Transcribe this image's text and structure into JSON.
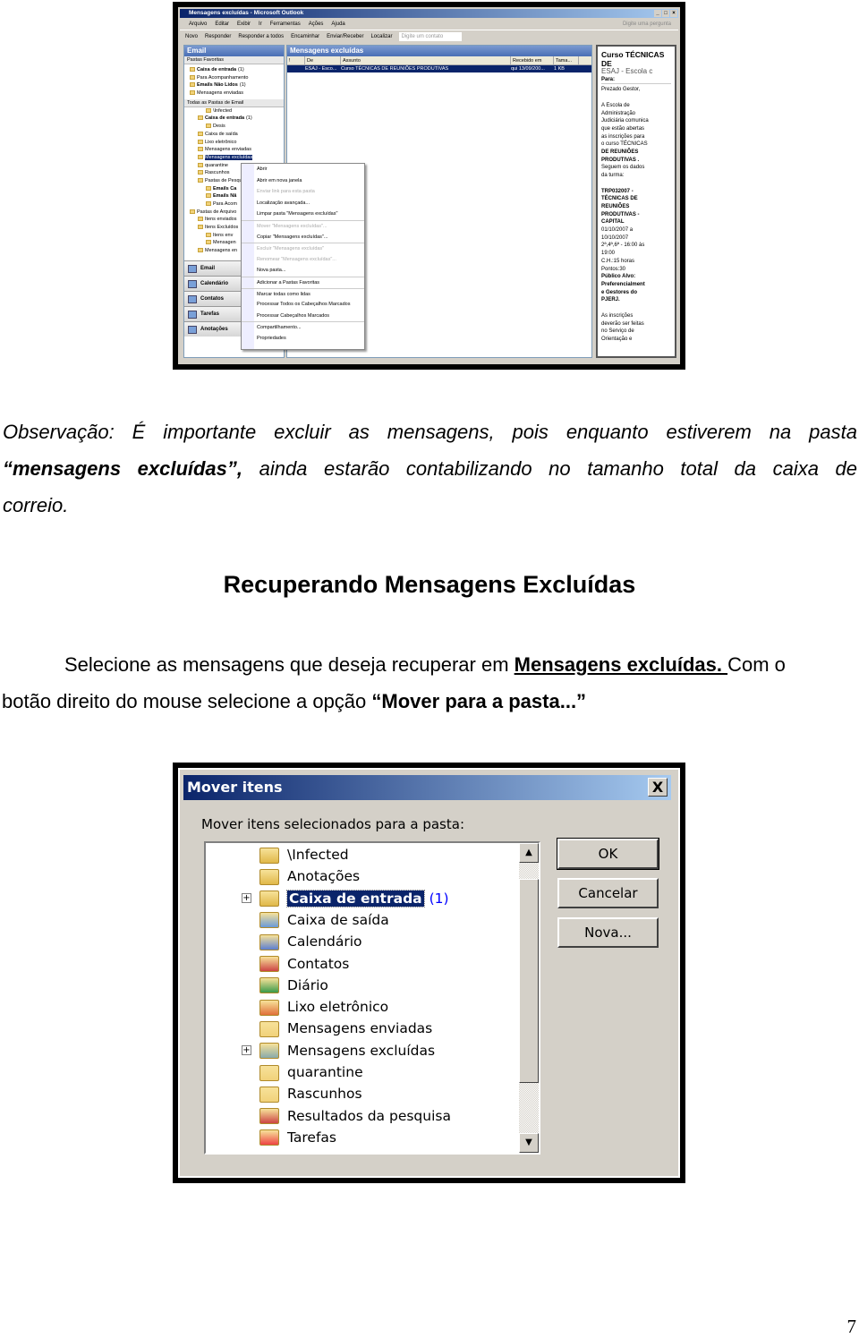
{
  "outlook": {
    "title": "Mensagens excluídas - Microsoft Outlook",
    "window_controls": [
      "_",
      "□",
      "×"
    ],
    "menu": [
      "Arquivo",
      "Editar",
      "Exibir",
      "Ir",
      "Ferramentas",
      "Ações",
      "Ajuda"
    ],
    "ask_placeholder": "Digite uma pergunta",
    "toolbar": [
      "Novo",
      "Responder",
      "Responder a todos",
      "Encaminhar",
      "Enviar/Receber",
      "Localizar"
    ],
    "contact_placeholder": "Digite um contato",
    "nav": {
      "header": "Email",
      "favorites_header": "Pastas Favoritas",
      "favorites": [
        {
          "label": "Caixa de entrada",
          "count": "(1)",
          "bold": true
        },
        {
          "label": "Para Acompanhamento"
        },
        {
          "label": "Emails Não Lidos",
          "count": "(1)",
          "bold": true
        },
        {
          "label": "Mensagens enviadas"
        }
      ],
      "all_header": "Todas as Pastas de Email",
      "tree": [
        {
          "label": "\\Infected",
          "lvl": 2
        },
        {
          "label": "Caixa de entrada",
          "count": "(1)",
          "lvl": 1,
          "bold": true
        },
        {
          "label": "Desis",
          "lvl": 2
        },
        {
          "label": "Caixa de saída",
          "lvl": 1
        },
        {
          "label": "Lixo eletrônico",
          "lvl": 1
        },
        {
          "label": "Mensagens enviadas",
          "lvl": 1
        },
        {
          "label": "Mensagens excluídas",
          "lvl": 1,
          "sel": true
        },
        {
          "label": "quarantine",
          "lvl": 1
        },
        {
          "label": "Rascunhos",
          "lvl": 1
        },
        {
          "label": "Pastas de Pesquisa",
          "lvl": 1
        },
        {
          "label": "Emails Ca",
          "lvl": 2,
          "bold": true
        },
        {
          "label": "Emails Nã",
          "lvl": 2,
          "bold": true
        },
        {
          "label": "Para Acom",
          "lvl": 2
        },
        {
          "label": "Pastas de Arquivo",
          "lvl": 0
        },
        {
          "label": "Itens enviados",
          "lvl": 1
        },
        {
          "label": "Itens Excluídos",
          "lvl": 1
        },
        {
          "label": "Itens env",
          "lvl": 2
        },
        {
          "label": "Mensagen",
          "lvl": 2
        },
        {
          "label": "Mensagens en",
          "lvl": 1
        }
      ],
      "buttons": [
        "Email",
        "Calendário",
        "Contatos",
        "Tarefas",
        "Anotações"
      ]
    },
    "list": {
      "header": "Mensagens excluídas",
      "columns": [
        "!",
        "De",
        "Assunto",
        "Recebido em",
        "Tama..."
      ],
      "rows": [
        {
          "from": "ESAJ - Esco...",
          "subject": "Curso TÉCNICAS DE REUNIÕES PRODUTIVAS",
          "received": "qui 13/09/200...",
          "size": "1 KB"
        }
      ]
    },
    "context_menu": [
      {
        "label": "Abrir"
      },
      {
        "label": "Abrir em nova janela"
      },
      {
        "label": "Enviar link para esta pasta",
        "disabled": true
      },
      {
        "label": "Localização avançada..."
      },
      {
        "label": "Limpar pasta \"Mensagens excluídas\""
      },
      {
        "label": "Mover \"Mensagens excluídas\"...",
        "disabled": true,
        "sep": true
      },
      {
        "label": "Copiar \"Mensagens excluídas\"..."
      },
      {
        "label": "Excluir \"Mensagens excluídas\"",
        "disabled": true,
        "sep": true
      },
      {
        "label": "Renomear \"Mensagens excluídas\"...",
        "disabled": true
      },
      {
        "label": "Nova pasta..."
      },
      {
        "label": "Adicionar a Pastas Favoritas",
        "sep": true
      },
      {
        "label": "Marcar todas como lidas",
        "sep": true
      },
      {
        "label": "Processar Todos os Cabeçalhos Marcados"
      },
      {
        "label": "Processar Cabeçalhos Marcados"
      },
      {
        "label": "Compartilhamento...",
        "sep": true
      },
      {
        "label": "Propriedades"
      }
    ],
    "reading": {
      "subject": "Curso TÉCNICAS DE",
      "sender": "ESAJ - Escola c",
      "to_label": "Para:",
      "body": [
        "Prezado Gestor,",
        "",
        "A Escola de",
        "Administração",
        "Judiciária comunica",
        "que estão abertas",
        "as inscrições para",
        "o curso TÉCNICAS",
        "DE REUNIÕES",
        "PRODUTIVAS .",
        "Seguem os dados",
        "da turma:",
        "",
        "TRP032007 -",
        "TÉCNICAS DE",
        "REUNIÕES",
        "PRODUTIVAS -",
        "CAPITAL",
        "01/10/2007 a",
        "10/10/2007",
        "2ª,4ª,6ª - 16:00 às",
        "19:00",
        "C.H.:15 horas",
        "Pontos:30",
        "Público Alvo:",
        "Preferencialment",
        "e Gestores do",
        "PJERJ.",
        "",
        "As inscrições",
        "deverão ser feitas",
        "no Serviço de",
        "Orientação e"
      ]
    }
  },
  "text": {
    "obs_l1": "Observação: É importante excluir as mensagens, pois enquanto estiverem na pasta",
    "obs_l2_bold": "“mensagens excluídas”,",
    "obs_l2": " ainda estarão contabilizando no tamanho total da caixa de",
    "obs_l3": "correio.",
    "heading": "Recuperando Mensagens Excluídas",
    "p2_a": "Selecione  as mensagens que deseja recuperar em ",
    "p2_link": "Mensagens excluídas. ",
    "p2_b": " Com o",
    "p2_c": "botão direito do mouse selecione a opção ",
    "p2_bold": "“Mover para a pasta...”"
  },
  "dialog": {
    "title": "Mover itens",
    "close": "X",
    "label": "Mover itens selecionados para a pasta:",
    "folders": [
      {
        "label": "\\Infected"
      },
      {
        "label": "Anotações"
      },
      {
        "label": "Caixa de entrada",
        "count": "(1)",
        "selected": true,
        "expandable": true
      },
      {
        "label": "Caixa de saída"
      },
      {
        "label": "Calendário"
      },
      {
        "label": "Contatos"
      },
      {
        "label": "Diário"
      },
      {
        "label": "Lixo eletrônico"
      },
      {
        "label": "Mensagens enviadas"
      },
      {
        "label": "Mensagens excluídas",
        "expandable": true
      },
      {
        "label": "quarantine"
      },
      {
        "label": "Rascunhos"
      },
      {
        "label": "Resultados da pesquisa"
      },
      {
        "label": "Tarefas"
      }
    ],
    "buttons": {
      "ok": "OK",
      "cancel": "Cancelar",
      "new": "Nova..."
    }
  },
  "page_number": "7"
}
